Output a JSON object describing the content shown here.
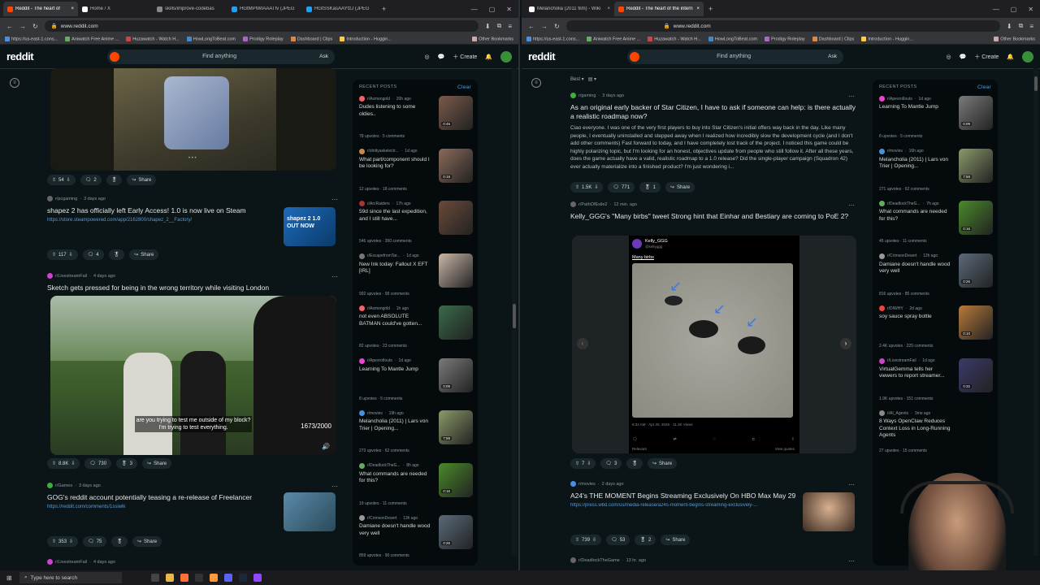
{
  "left": {
    "tabs": [
      {
        "label": "Reddit - The heart of",
        "color": "#ff4500",
        "active": true
      },
      {
        "label": "Home / X",
        "color": "#ffffff",
        "active": false
      },
      {
        "label": "skills/improve-codebas",
        "color": "#888888",
        "active": false
      },
      {
        "label": "HGtMPlWIAAATfv (JPEG",
        "color": "#1da1f2",
        "active": false
      },
      {
        "label": "HGtSSKasAAYfzJ (JPEG",
        "color": "#1da1f2",
        "active": false
      }
    ],
    "url": "www.reddit.com",
    "bookmarks": [
      "https://us-east-1.cons...",
      "Aniwatch Free Anime ...",
      "Huzawatch - Watch H...",
      "HowLongToBeat.com",
      "Prodigy Roleplay",
      "Dashboard | Clips",
      "Introduction - Huggin...",
      "Other Bookmarks"
    ],
    "header": {
      "logo": "reddit",
      "search_placeholder": "Find anything",
      "ask": "Ask",
      "create": "Create"
    },
    "posts": [
      {
        "sub": "",
        "time": "",
        "title": "",
        "link": "",
        "votes": "54",
        "comments": "2",
        "share": "Share"
      },
      {
        "sub": "r/pcgaming",
        "time": "3 days ago",
        "title": "shapez 2 has officially left Early Access! 1.0 is now live on Steam",
        "link": "https://store.steampowered.com/app/2162800/shapez_2__Factory/",
        "votes": "117",
        "comments": "4",
        "share": "Share",
        "thumb_text": "shapez 2 1.0 OUT NOW"
      },
      {
        "sub": "r/LivestreamFail",
        "time": "4 days ago",
        "title": "Sketch gets pressed for being in the wrong territory while visiting London",
        "link": "",
        "votes": "8.8K",
        "comments": "730",
        "awards": "3",
        "share": "Share",
        "caption": "are you trying to test me outside of my block? I'm trying to test everything.",
        "counter": "1673/2000"
      },
      {
        "sub": "r/Games",
        "time": "3 days ago",
        "title": "GOG's reddit account potentially teasing a re-release of Freelancer",
        "link": "https://reddit.com/comments/1ssiwlk",
        "votes": "353",
        "comments": "75",
        "share": "Share"
      },
      {
        "sub": "r/LivestreamFail",
        "time": "4 days ago",
        "title": "",
        "link": "",
        "votes": "",
        "comments": "",
        "share": ""
      }
    ],
    "recent": {
      "heading": "RECENT POSTS",
      "clear": "Clear",
      "items": [
        {
          "sub": "r/Asmongold",
          "time": "20h ago",
          "title": "Dudes listening to some oldies..",
          "upvotes": "78 upvotes",
          "comments": "5 comments",
          "dur": "0:45",
          "color": "#7a5a4a",
          "icon": "#e66"
        },
        {
          "sub": "r/shittyaskelectr...",
          "time": "1d ago",
          "title": "What part/component should I be looking for?",
          "upvotes": "12 upvotes",
          "comments": "18 comments",
          "dur": "0:19",
          "color": "#8a6a5a",
          "icon": "#c84"
        },
        {
          "sub": "r/ArcRaiders",
          "time": "17h ago",
          "title": "59d since the last expedition, and I still have...",
          "upvotes": "546 upvotes",
          "comments": "350 comments",
          "dur": "",
          "color": "#6a4a3a",
          "icon": "#a33"
        },
        {
          "sub": "r/EscapefromTar...",
          "time": "1d ago",
          "title": "New Ink today: Fallout X EFT [IRL]",
          "upvotes": "992 upvotes",
          "comments": "99 comments",
          "dur": "",
          "color": "#c9b8a8",
          "icon": "#777"
        },
        {
          "sub": "r/Asmongold",
          "time": "1h ago",
          "title": "not even ABSOLUTE BATMAN could've gotten...",
          "upvotes": "82 upvotes",
          "comments": "23 comments",
          "dur": "",
          "color": "#3a6a4a",
          "icon": "#e66"
        },
        {
          "sub": "r/ApexrolIouts",
          "time": "1d ago",
          "title": "Learning To Mantle Jump",
          "upvotes": "8 upvotes",
          "comments": "5 comments",
          "dur": "0:09",
          "color": "#7a7a7a",
          "icon": "#e4c"
        },
        {
          "sub": "r/movies",
          "time": "19h ago",
          "title": "Melancholia (2011) | Lars von Trier | Opening...",
          "upvotes": "273 upvotes",
          "comments": "62 comments",
          "dur": "7:59",
          "color": "#8a9a6a",
          "icon": "#4a90e2"
        },
        {
          "sub": "r/DeadlockTheG...",
          "time": "8h ago",
          "title": "What commands are needed for this?",
          "upvotes": "19 upvotes",
          "comments": "11 comments",
          "dur": "0:16",
          "color": "#4a8a2a",
          "icon": "#6a6"
        },
        {
          "sub": "r/CrimsonDesert",
          "time": "13h ago",
          "title": "Damiane doesn't handle wood very well",
          "upvotes": "859 upvotes",
          "comments": "90 comments",
          "dur": "0:26",
          "color": "#5a6a7a",
          "icon": "#999"
        }
      ]
    }
  },
  "right": {
    "tabs": [
      {
        "label": "Melancholia (2011 film) - Wiki",
        "color": "#ffffff",
        "active": false
      },
      {
        "label": "Reddit - The heart of the intern",
        "color": "#ff4500",
        "active": true
      }
    ],
    "url": "www.reddit.com",
    "sort": "Best",
    "posts": [
      {
        "sub": "r/gaming",
        "time": "3 days ago",
        "title": "As an original early backer of Star Citizen, I have to ask if someone can help: is there actually a realistic roadmap now?",
        "text": "Ciao everyone. I was one of the very first players to buy into Star Citizen's initial offers way back in the day. Like many people, I eventually uninstalled and stepped away when I realized how incredibly slow the development cycle (and I don't add other comments) Fast forward to today, and I have completely lost track of the project. I noticed this game could be highly polarizing topic, but I'm looking for an honest, objectives update from people who still follow it. After all these years, does the game actually have a valid, realistic roadmap to a 1.0 release? Did the single-player campaign (Squadron 42) ever actually materialize into a finished product? I'm just wondering i...",
        "votes": "1.5K",
        "comments": "771",
        "awards": "1",
        "share": "Share"
      },
      {
        "sub": "r/PathOfExile2",
        "time": "12 min. ago",
        "title": "Kelly_GGG's \"Many birbs\" tweet Strong hint that Einhar and Bestiary are coming to PoE 2?",
        "votes": "7",
        "comments": "3",
        "share": "Share",
        "tweet_user": "Kelly_GGG",
        "tweet_handle": "@kellyggg",
        "tweet_text": "Many birbs",
        "tweet_time": "6:34 AM · Apr 25, 2026 · 11.2K Views",
        "tweet_relevant": "Relevant",
        "tweet_quotes": "View quotes"
      },
      {
        "sub": "r/movies",
        "time": "2 days ago",
        "title": "A24's THE MOMENT Begins Streaming Exclusively On HBO Max May 29",
        "link": "https://press.wbd.com/us/media-release/a24s-moment-begins-streaming-exclusively-...",
        "votes": "739",
        "comments": "53",
        "awards": "2",
        "share": "Share"
      },
      {
        "sub": "r/DeadlockTheGame",
        "time": "13 hr. ago"
      }
    ],
    "recent": {
      "heading": "RECENT POSTS",
      "clear": "Clear",
      "items": [
        {
          "sub": "r/ApexrolIouts",
          "time": "1d ago",
          "title": "Learning To Mantle Jump",
          "upvotes": "8 upvotes",
          "comments": "5 comments",
          "dur": "0:09",
          "color": "#7a7a7a",
          "icon": "#e4c"
        },
        {
          "sub": "r/movies",
          "time": "16h ago",
          "title": "Melancholia (2011) | Lars von Trier | Opening...",
          "upvotes": "271 upvotes",
          "comments": "62 comments",
          "dur": "7:59",
          "color": "#8a9a6a",
          "icon": "#4a90e2"
        },
        {
          "sub": "r/DeadlockTheG...",
          "time": "7h ago",
          "title": "What commands are needed for this?",
          "upvotes": "45 upvotes",
          "comments": "11 comments",
          "dur": "0:16",
          "color": "#4a8a2a",
          "icon": "#6a6"
        },
        {
          "sub": "r/CrimsonDesert",
          "time": "12h ago",
          "title": "Damiane doesn't handle wood very well",
          "upvotes": "816 upvotes",
          "comments": "85 comments",
          "dur": "0:26",
          "color": "#5a6a7a",
          "icon": "#999"
        },
        {
          "sub": "r/DIWHY",
          "time": "2d ago",
          "title": "soy sauce spray bottle",
          "upvotes": "2.4K upvotes",
          "comments": "220 comments",
          "dur": "0:10",
          "color": "#b87a3a",
          "icon": "#e44"
        },
        {
          "sub": "r/LivestreamFail",
          "time": "1d ago",
          "title": "VirtualGemma tells her viewers to report streamer...",
          "upvotes": "1.9K upvotes",
          "comments": "151 comments",
          "dur": "0:32",
          "color": "#3a3a6a",
          "icon": "#c4c"
        },
        {
          "sub": "r/AI_Agents",
          "time": "3mo ago",
          "title": "8 Ways OpenClaw Reduces Context Loss in Long-Running Agents",
          "upvotes": "27 upvotes",
          "comments": "15 comments",
          "dur": "",
          "color": "",
          "icon": "#888"
        }
      ]
    }
  },
  "taskbar": {
    "search_placeholder": "Type here to search"
  },
  "colors": {
    "accent": "#ff4500",
    "bg": "#0b1416",
    "link": "#5b9bd5"
  }
}
